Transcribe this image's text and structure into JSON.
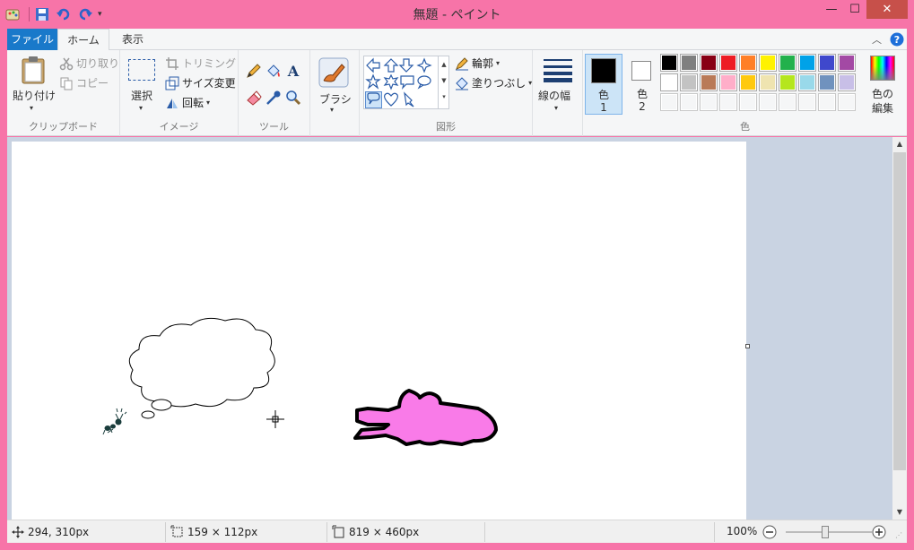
{
  "window": {
    "title": "無題 - ペイント",
    "minimize": "—",
    "maximize": "☐",
    "close": "✕"
  },
  "tabs": [
    {
      "label": "ファイル"
    },
    {
      "label": "ホーム"
    },
    {
      "label": "表示"
    }
  ],
  "clipboard": {
    "paste": "貼り付け",
    "cut": "切り取り",
    "copy": "コピー",
    "group": "クリップボード"
  },
  "image": {
    "select": "選択",
    "crop": "トリミング",
    "resize": "サイズ変更",
    "rotate": "回転",
    "group": "イメージ"
  },
  "tools": {
    "group": "ツール",
    "brushes": "ブラシ"
  },
  "shapes": {
    "outline": "輪郭",
    "fill": "塗りつぶし",
    "group": "図形"
  },
  "size": {
    "label": "線の幅"
  },
  "colors": {
    "color1_line1": "色",
    "color1_line2": "1",
    "color2_line1": "色",
    "color2_line2": "2",
    "edit_line1": "色の",
    "edit_line2": "編集",
    "group": "色",
    "palette_row1": [
      "#000000",
      "#7f7f7f",
      "#880015",
      "#ed1c24",
      "#ff7f27",
      "#fff200",
      "#22b14c",
      "#00a2e8",
      "#3f48cc",
      "#a349a4"
    ],
    "palette_row2": [
      "#ffffff",
      "#c3c3c3",
      "#b97a57",
      "#ffaec9",
      "#ffc90e",
      "#efe4b0",
      "#b5e61d",
      "#99d9ea",
      "#7092be",
      "#c8bfe7"
    ]
  },
  "status": {
    "cursor": "294, 310px",
    "selection": "159 × 112px",
    "canvas_size": "819 × 460px",
    "zoom": "100%"
  },
  "accent": "#1979ca",
  "frame_color": "#f774a8",
  "crocodile_color": "#f97be8"
}
